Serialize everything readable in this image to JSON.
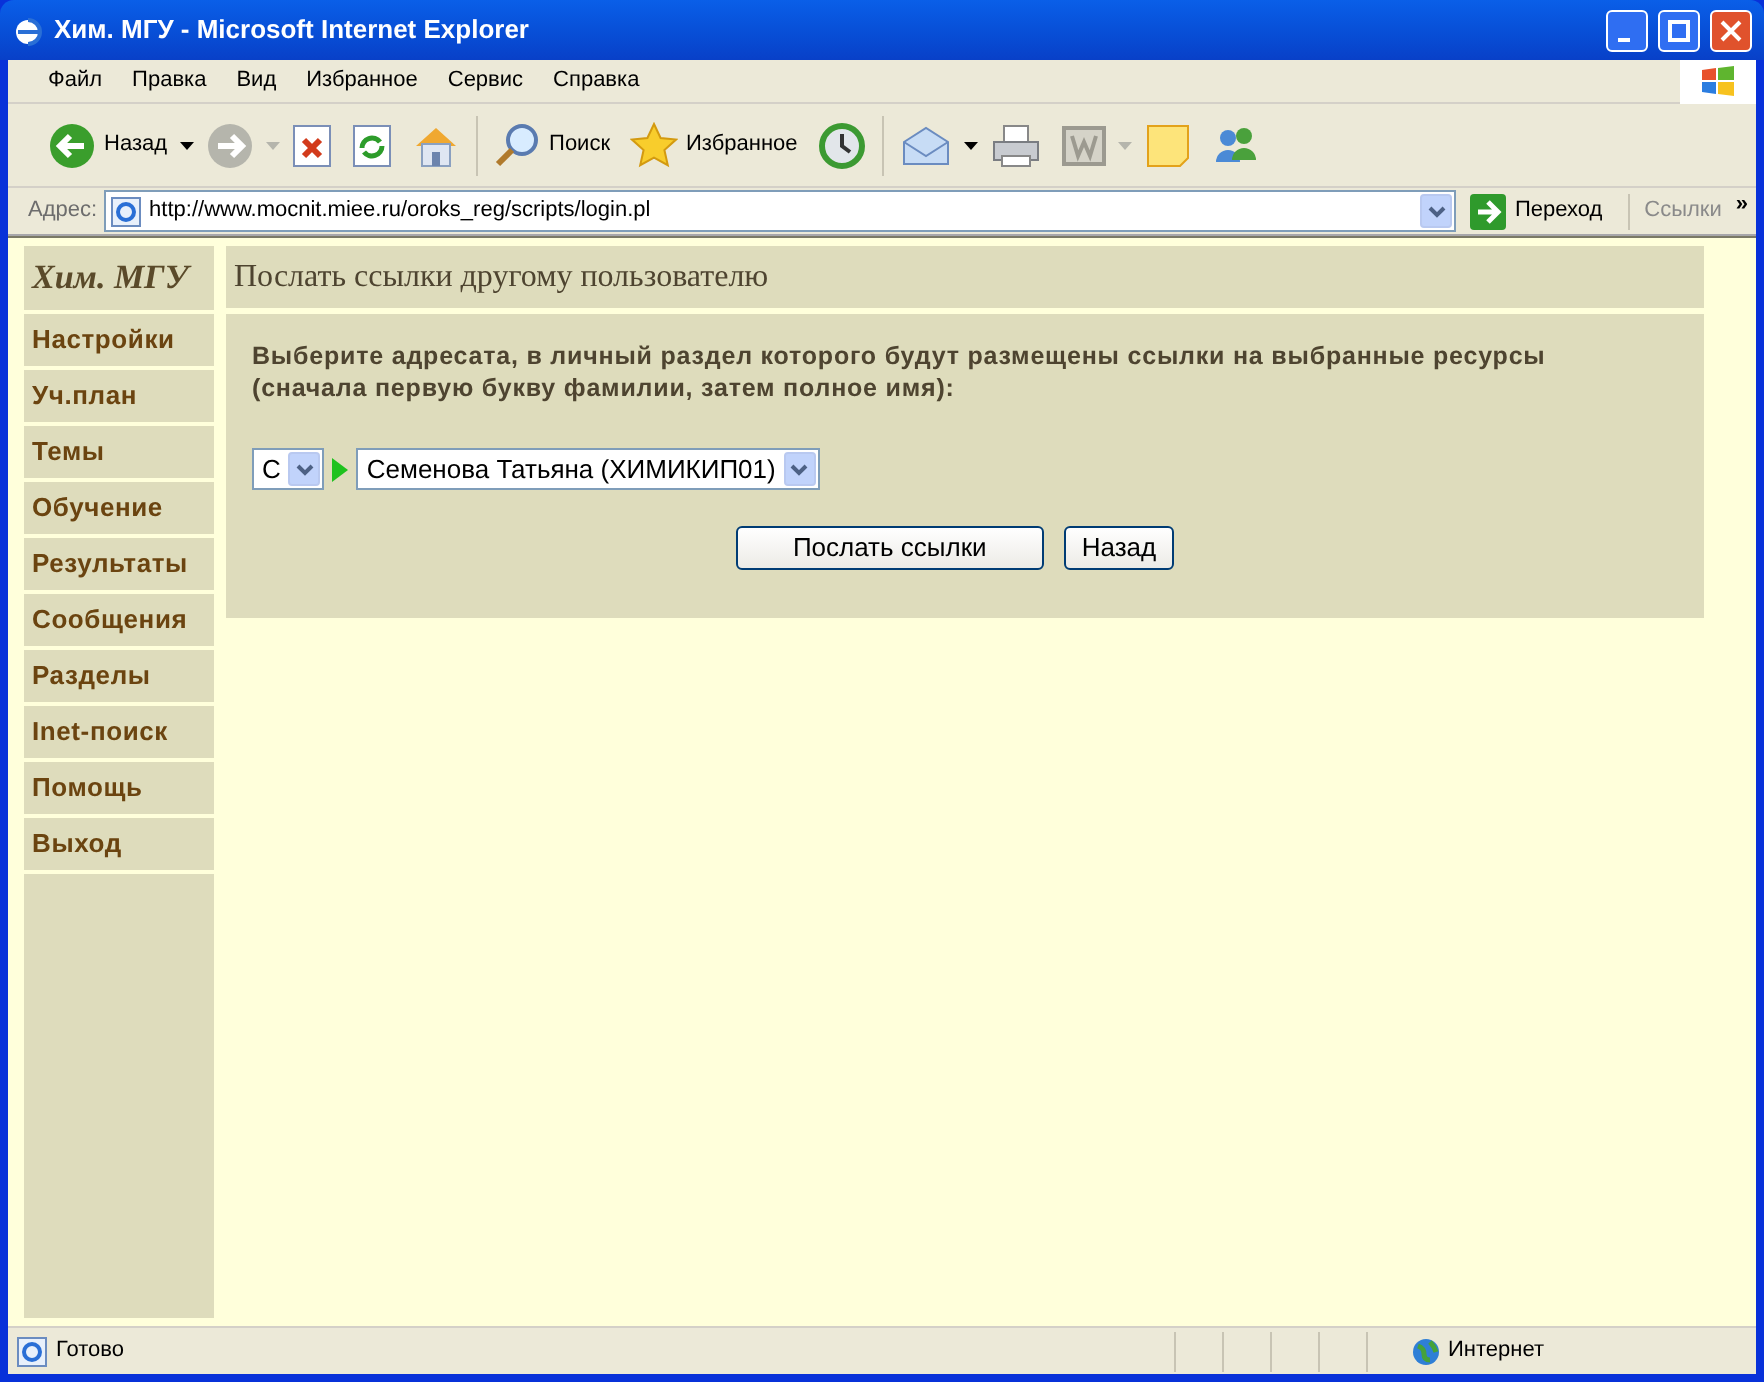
{
  "window": {
    "title": "Хим. МГУ - Microsoft Internet Explorer"
  },
  "menu": [
    "Файл",
    "Правка",
    "Вид",
    "Избранное",
    "Сервис",
    "Справка"
  ],
  "toolbar": {
    "back": "Назад",
    "search": "Поиск",
    "favorites": "Избранное"
  },
  "address": {
    "label": "Адрес:",
    "url": "http://www.mocnit.miee.ru/oroks_reg/scripts/login.pl",
    "go": "Переход",
    "links": "Ссылки",
    "more": "»"
  },
  "page": {
    "site_title": "Хим. МГУ",
    "nav": [
      "Настройки",
      "Уч.план",
      "Темы",
      "Обучение",
      "Результаты",
      "Сообщения",
      "Разделы",
      "Inet-поиск",
      "Помощь",
      "Выход"
    ],
    "heading": "Послать ссылки другому пользователю",
    "instruction": "Выберите адресата, в личный раздел которого будут размещены ссылки на выбранные ресурсы (сначала первую букву фамилии, затем полное имя):",
    "letter": "С",
    "recipient": "Семенова Татьяна (ХИМИКИП01)",
    "buttons": [
      "Послать ссылки",
      "Назад"
    ]
  },
  "status_bar": {
    "text": "Готово",
    "zone": "Интернет"
  }
}
